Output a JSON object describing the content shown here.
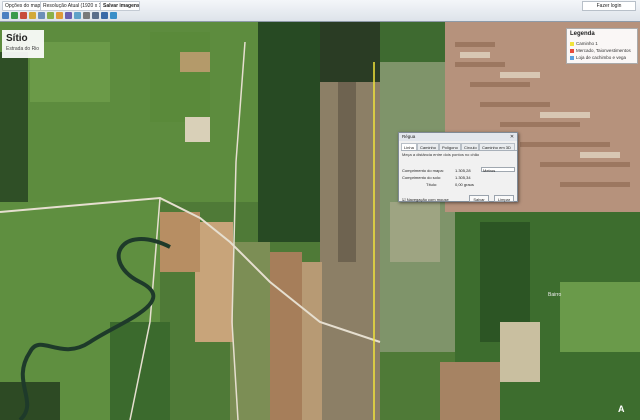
{
  "toolbar": {
    "map_options": "Opções do mapa",
    "resolution": "Resolução Atual (1920 x 1920)",
    "save_images": "Salvar imagens...",
    "login": "Fazer login"
  },
  "map": {
    "title": "Sítio",
    "subtitle": "Estrada do Rio",
    "legend": {
      "title": "Legenda",
      "items": [
        {
          "label": "Caminho 1",
          "color": "#f1e33a"
        },
        {
          "label": "Mercado, Taionvestimentos",
          "color": "#e64b3b"
        },
        {
          "label": "Loja de cachimbo e vega",
          "color": "#5aa0e0"
        }
      ]
    },
    "bottom_mark": "A",
    "scale_label": "Bairro"
  },
  "dialog": {
    "title": "Régua",
    "close": "✕",
    "tabs": [
      "Linha",
      "Caminho",
      "Polígono",
      "Círculo",
      "Caminho em 3D"
    ],
    "active_tab": 0,
    "info": "Meça a distância entre dois pontos no chão",
    "rows": [
      {
        "label": "Comprimento do mapa:",
        "value": "1.305,28",
        "unit": "Metros"
      },
      {
        "label": "Comprimento do solo:",
        "value": "1.305,34",
        "unit": ""
      },
      {
        "label": "Título:",
        "value": "0,00 graus",
        "unit": ""
      }
    ],
    "checkbox": "Navegação com mouse",
    "save": "Salvar",
    "clear": "Limpar"
  }
}
